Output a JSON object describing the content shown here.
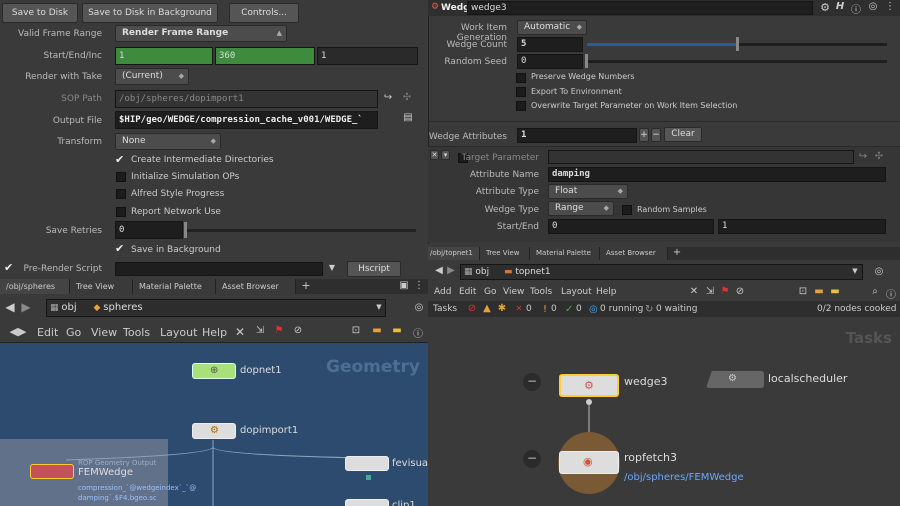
{
  "left_params": {
    "buttons": {
      "save_to_disk": "Save to Disk",
      "save_bg": "Save to Disk in Background",
      "controls": "Controls..."
    },
    "valid_frame_range": {
      "label": "Valid Frame Range",
      "value": "Render Frame Range"
    },
    "start_end_inc": {
      "label": "Start/End/Inc",
      "start": "1",
      "end": "360",
      "inc": "1"
    },
    "render_with_take": {
      "label": "Render with Take",
      "value": "(Current)"
    },
    "sop_path": {
      "label": "SOP Path",
      "value": "/obj/spheres/dopimport1"
    },
    "output_file": {
      "label": "Output File",
      "value": "$HIP/geo/WEDGE/compression_cache_v001/WEDGE_`"
    },
    "transform": {
      "label": "Transform",
      "value": "None"
    },
    "checks": {
      "create_dirs": "Create Intermediate Directories",
      "init_sim": "Initialize Simulation OPs",
      "alfred": "Alfred Style Progress",
      "report_net": "Report Network Use"
    },
    "save_retries": {
      "label": "Save Retries",
      "value": "0"
    },
    "save_in_bg": "Save in Background",
    "pre_render": {
      "label": "Pre-Render Script",
      "hscript": "Hscript"
    }
  },
  "wedge_panel": {
    "title": "Wedge",
    "node_name": "wedge3",
    "work_item_gen": {
      "label": "Work Item Generation",
      "value": "Automatic"
    },
    "wedge_count": {
      "label": "Wedge Count",
      "value": "5",
      "fraction": 0.5
    },
    "random_seed": {
      "label": "Random Seed",
      "value": "0"
    },
    "checks": {
      "preserve": "Preserve Wedge Numbers",
      "export_env": "Export To Environment",
      "overwrite": "Overwrite Target Parameter on Work Item Selection"
    },
    "wedge_attributes": {
      "label": "Wedge Attributes",
      "value": "1",
      "clear": "Clear"
    },
    "target_parameter": {
      "label": "Target Parameter"
    },
    "attribute_name": {
      "label": "Attribute Name",
      "value": "damping"
    },
    "attribute_type": {
      "label": "Attribute Type",
      "value": "Float"
    },
    "wedge_type": {
      "label": "Wedge Type",
      "value": "Range",
      "random_samples": "Random Samples"
    },
    "start_end": {
      "label": "Start/End",
      "start": "0",
      "end": "1"
    }
  },
  "left_net": {
    "tabs": [
      "/obj/spheres",
      "Tree View",
      "Material Palette",
      "Asset Browser"
    ],
    "path": [
      "obj",
      "spheres"
    ],
    "menu": [
      "Edit",
      "Go",
      "View",
      "Tools",
      "Layout",
      "Help"
    ],
    "watermark": "Geometry",
    "nodes": {
      "dopnet": "dopnet1",
      "dopimport": "dopimport1",
      "femwedge": "FEMWedge",
      "fevis": "fevisualiz",
      "clip": "clip1"
    },
    "rop_header": "ROP Geometry Output",
    "rop_line1": "compression_`@wedgeindex`_`@",
    "rop_line2": "damping`.$F4.bgeo.sc"
  },
  "right_net": {
    "tabs": [
      "/obj/topnet1",
      "Tree View",
      "Material Palette",
      "Asset Browser"
    ],
    "path": [
      "obj",
      "topnet1"
    ],
    "menu": [
      "Add",
      "Edit",
      "Go",
      "View",
      "Tools",
      "Layout",
      "Help"
    ],
    "status": {
      "tasks": "Tasks",
      "err": "0",
      "warn": "0",
      "ok": "0",
      "running": "0 running",
      "waiting": "0 waiting",
      "cooked": "0/2 nodes cooked"
    },
    "watermark": "Tasks",
    "nodes": {
      "wedge": "wedge3",
      "scheduler": "localscheduler",
      "ropfetch": "ropfetch3",
      "ropfetch_path": "/obj/spheres/FEMWedge"
    }
  }
}
